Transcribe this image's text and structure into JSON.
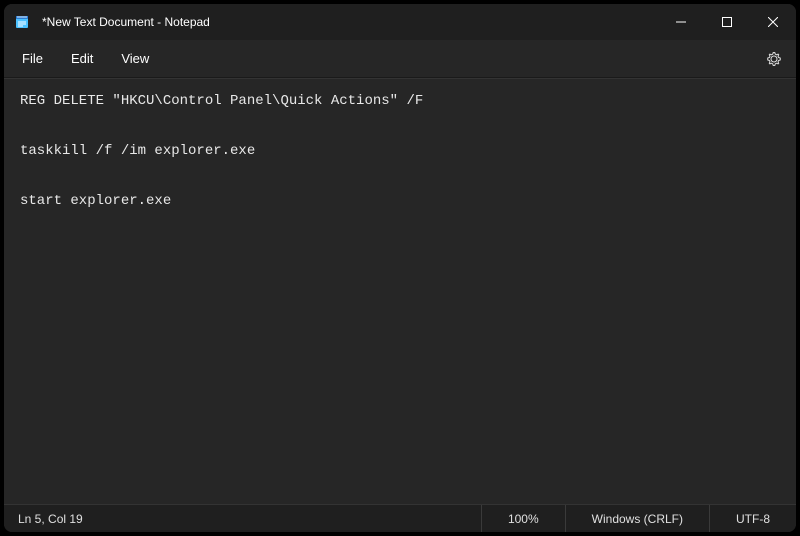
{
  "titlebar": {
    "title": "*New Text Document - Notepad"
  },
  "menubar": {
    "file": "File",
    "edit": "Edit",
    "view": "View"
  },
  "editor": {
    "content": "REG DELETE \"HKCU\\Control Panel\\Quick Actions\" /F\n\ntaskkill /f /im explorer.exe\n\nstart explorer.exe"
  },
  "statusbar": {
    "position": "Ln 5, Col 19",
    "zoom": "100%",
    "line_ending": "Windows (CRLF)",
    "encoding": "UTF-8"
  }
}
